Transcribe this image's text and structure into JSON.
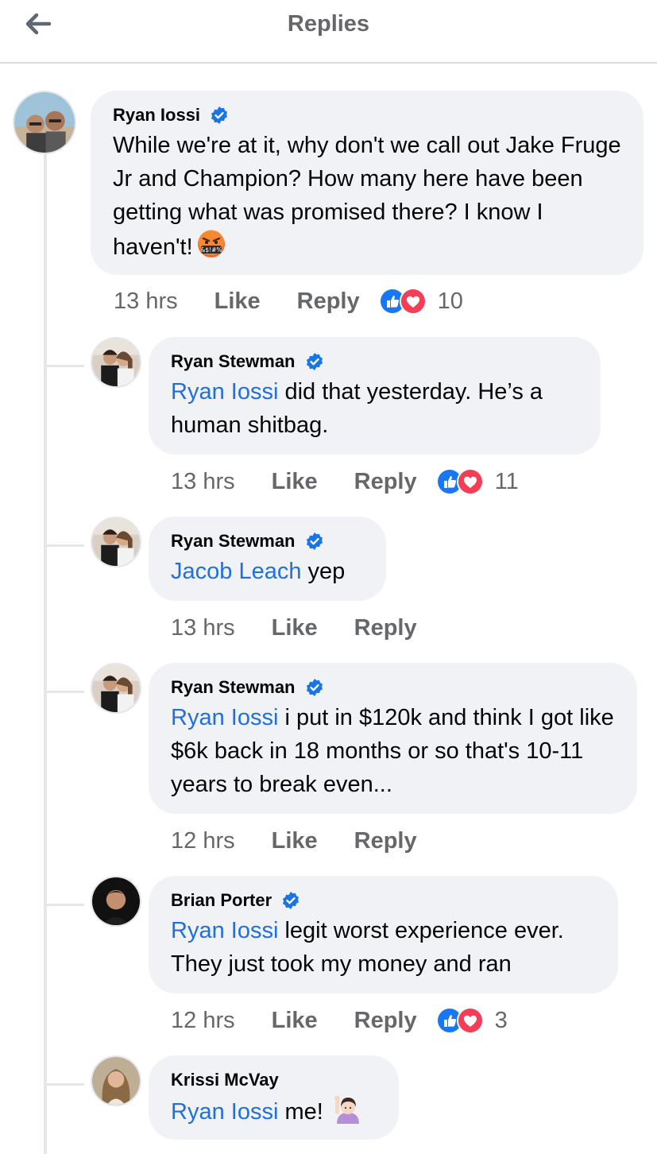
{
  "header": {
    "title": "Replies"
  },
  "comments": [
    {
      "author": "Ryan Iossi",
      "verified": true,
      "text": "While we're at it, why don't we call out Jake Fruge Jr and Champion?  How many here have been getting what was promised there? I know I haven't!",
      "emoji": "face-with-symbols-on-mouth",
      "time": "13 hrs",
      "like": "Like",
      "reply": "Reply",
      "reactions": [
        "like-icon",
        "love-icon"
      ],
      "reaction_count": "10"
    },
    {
      "author": "Ryan Stewman",
      "verified": true,
      "mention": "Ryan Iossi",
      "text": " did that yesterday. He’s a human shitbag.",
      "time": "13 hrs",
      "like": "Like",
      "reply": "Reply",
      "reactions": [
        "like-icon",
        "love-icon"
      ],
      "reaction_count": "11"
    },
    {
      "author": "Ryan Stewman",
      "verified": true,
      "mention": "Jacob Leach",
      "text": " yep",
      "time": "13 hrs",
      "like": "Like",
      "reply": "Reply"
    },
    {
      "author": "Ryan Stewman",
      "verified": true,
      "mention": "Ryan Iossi",
      "text": " i put in $120k and think I got like $6k back in 18 months or so that's 10-11 years to break even...",
      "time": "12 hrs",
      "like": "Like",
      "reply": "Reply"
    },
    {
      "author": "Brian Porter",
      "verified": true,
      "mention": "Ryan Iossi",
      "text": " legit worst experience ever. They just took my money and ran",
      "time": "12 hrs",
      "like": "Like",
      "reply": "Reply",
      "reactions": [
        "like-icon",
        "love-icon"
      ],
      "reaction_count": "3"
    },
    {
      "author": "Krissi McVay",
      "verified": false,
      "mention": "Ryan Iossi",
      "text": " me!",
      "emoji": "woman-raising-hand"
    }
  ],
  "colors": {
    "mention": "#216fdb",
    "verified": "#1b74e4",
    "like": "#1877f2",
    "love": "#f33e58"
  }
}
